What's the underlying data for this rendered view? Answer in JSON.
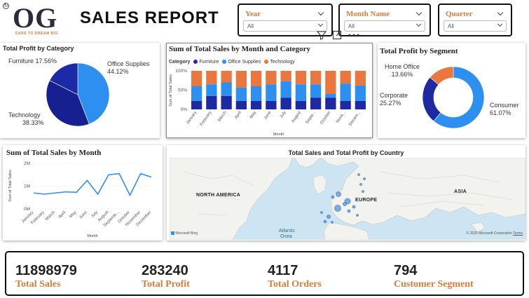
{
  "header": {
    "logo_text": "OG",
    "logo_tagline": "DARE TO DREAM BIG",
    "title": "SALES  REPORT"
  },
  "slicers": [
    {
      "label": "Year",
      "value": "All"
    },
    {
      "label": "Month Name",
      "value": "All"
    },
    {
      "label": "Quarter",
      "value": "All"
    }
  ],
  "profit_by_category": {
    "title": "Total Profit by Category",
    "labels": [
      {
        "name": "Furniture",
        "pct": "17.56%"
      },
      {
        "name": "Office Supplies",
        "pct": "44.12%"
      },
      {
        "name": "Technology",
        "pct": "38.33%"
      }
    ]
  },
  "sales_month_category": {
    "title": "Sum of Total Sales by Month and Category",
    "legend_title": "Category",
    "ylabel": "Sum of Total Sales",
    "xlabel": "Month"
  },
  "profit_by_segment": {
    "title": "Total Profit by Segment",
    "labels": [
      {
        "name": "Home Office",
        "pct": "13.66%"
      },
      {
        "name": "Corporate",
        "pct": "25.27%"
      },
      {
        "name": "Consumer",
        "pct": "61.07%"
      }
    ]
  },
  "sales_by_month": {
    "title": "Sum of Total Sales by Month",
    "ylabel": "Sum of Total Sales",
    "xlabel": "Month"
  },
  "map": {
    "title": "Total Sales and Total Profit by Country",
    "labels": {
      "north_america": "NORTH AMERICA",
      "europe": "EUROPE",
      "asia": "ASIA",
      "atlantic": "Atlantic",
      "ocean": "Ocea"
    },
    "brand": "Microsoft Bing",
    "copyright": "© 2025 Microsoft Corporation",
    "terms": "Terms"
  },
  "kpis": [
    {
      "value": "11898979",
      "label": "Total Sales"
    },
    {
      "value": "283240",
      "label": "Total Profit"
    },
    {
      "value": "4117",
      "label": "Total Orders"
    },
    {
      "value": "794",
      "label": "Customer Segment"
    }
  ],
  "colors": {
    "furniture": "#1f2aa0",
    "office": "#2d8ff0",
    "technology": "#e9773e",
    "accent": "#d77d3a"
  },
  "chart_data": [
    {
      "type": "pie",
      "title": "Total Profit by Category",
      "categories": [
        "Furniture",
        "Office Supplies",
        "Technology"
      ],
      "values": [
        17.56,
        44.12,
        38.33
      ]
    },
    {
      "type": "bar",
      "stacked": "percent",
      "title": "Sum of Total Sales by Month and Category",
      "categories": [
        "January",
        "February",
        "March",
        "April",
        "May",
        "June",
        "July",
        "August",
        "September",
        "October",
        "November",
        "December"
      ],
      "tick_labels": [
        "January",
        "February",
        "March",
        "April",
        "May",
        "June",
        "July",
        "August",
        "Septe...",
        "October",
        "Nove...",
        "Decem..."
      ],
      "series": [
        {
          "name": "Furniture",
          "values": [
            22,
            35,
            35,
            22,
            22,
            22,
            30,
            22,
            30,
            30,
            22,
            22
          ]
        },
        {
          "name": "Office Supplies",
          "values": [
            38,
            30,
            35,
            35,
            38,
            43,
            43,
            43,
            35,
            10,
            45,
            40
          ]
        },
        {
          "name": "Technology",
          "values": [
            40,
            35,
            30,
            43,
            40,
            35,
            27,
            35,
            35,
            60,
            33,
            38
          ]
        }
      ],
      "ytick_labels": [
        "0%",
        "50%",
        "100%"
      ],
      "ylim": [
        0,
        100
      ],
      "xlabel": "Month",
      "ylabel": "Sum of Total Sales",
      "legend": "top"
    },
    {
      "type": "pie",
      "donut": true,
      "title": "Total Profit by Segment",
      "categories": [
        "Consumer",
        "Corporate",
        "Home Office"
      ],
      "values": [
        61.07,
        25.27,
        13.66
      ]
    },
    {
      "type": "line",
      "title": "Sum of Total Sales by Month",
      "categories": [
        "January",
        "February",
        "March",
        "April",
        "May",
        "June",
        "July",
        "August",
        "September",
        "October",
        "November",
        "December"
      ],
      "tick_labels": [
        "January",
        "February",
        "March",
        "April",
        "May",
        "June",
        "July",
        "August",
        "Septemb...",
        "October",
        "November",
        "December"
      ],
      "values": [
        700000,
        650000,
        700000,
        750000,
        730000,
        1250000,
        650000,
        1500000,
        1550000,
        600000,
        1550000,
        1400000
      ],
      "ytick_labels": [
        "0M",
        "1M",
        "2M"
      ],
      "ylim": [
        0,
        2000000
      ],
      "xlabel": "Month",
      "ylabel": "Sum of Total Sales"
    }
  ]
}
